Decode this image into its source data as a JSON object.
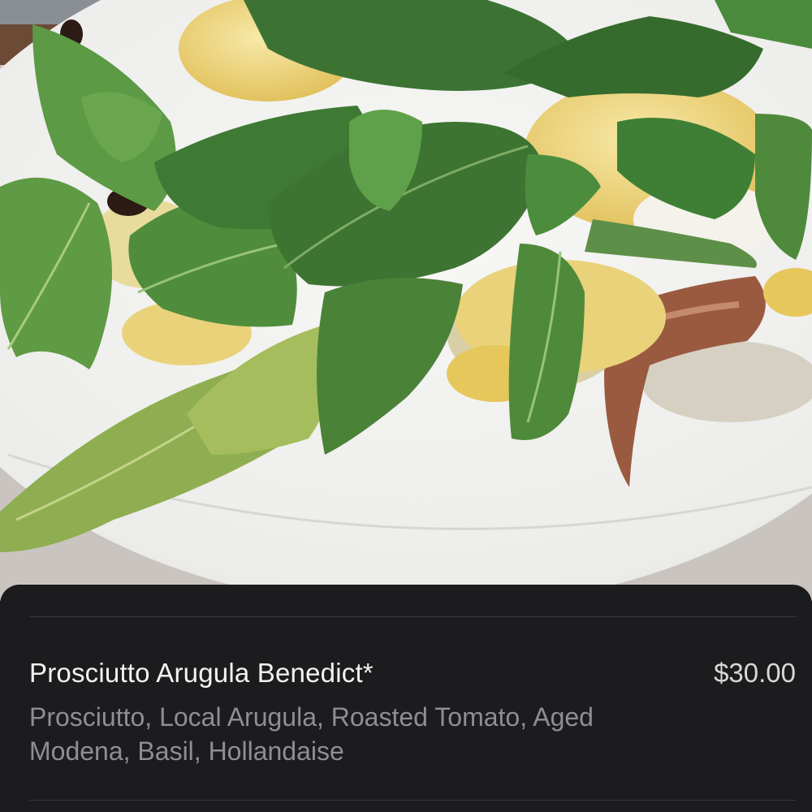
{
  "photo": {
    "icon": "food-photo-icon",
    "colors": {
      "plate": "#efefed",
      "table": "#6b4a36",
      "arugula_dark": "#3f7a34",
      "arugula_light": "#7ea74a",
      "hollandaise": "#e9d27a",
      "prosciutto": "#9a5a40"
    }
  },
  "menu_item": {
    "name": "Prosciutto Arugula Benedict*",
    "price": "$30.00",
    "description": "Prosciutto, Local Arugula, Roasted Tomato, Aged Modena, Basil, Hollandaise"
  },
  "colors": {
    "sheet_background": "#1c1c1e",
    "name_text": "#f2f2f2",
    "description_text": "#8e8e93",
    "divider": "#3a3a3c"
  }
}
